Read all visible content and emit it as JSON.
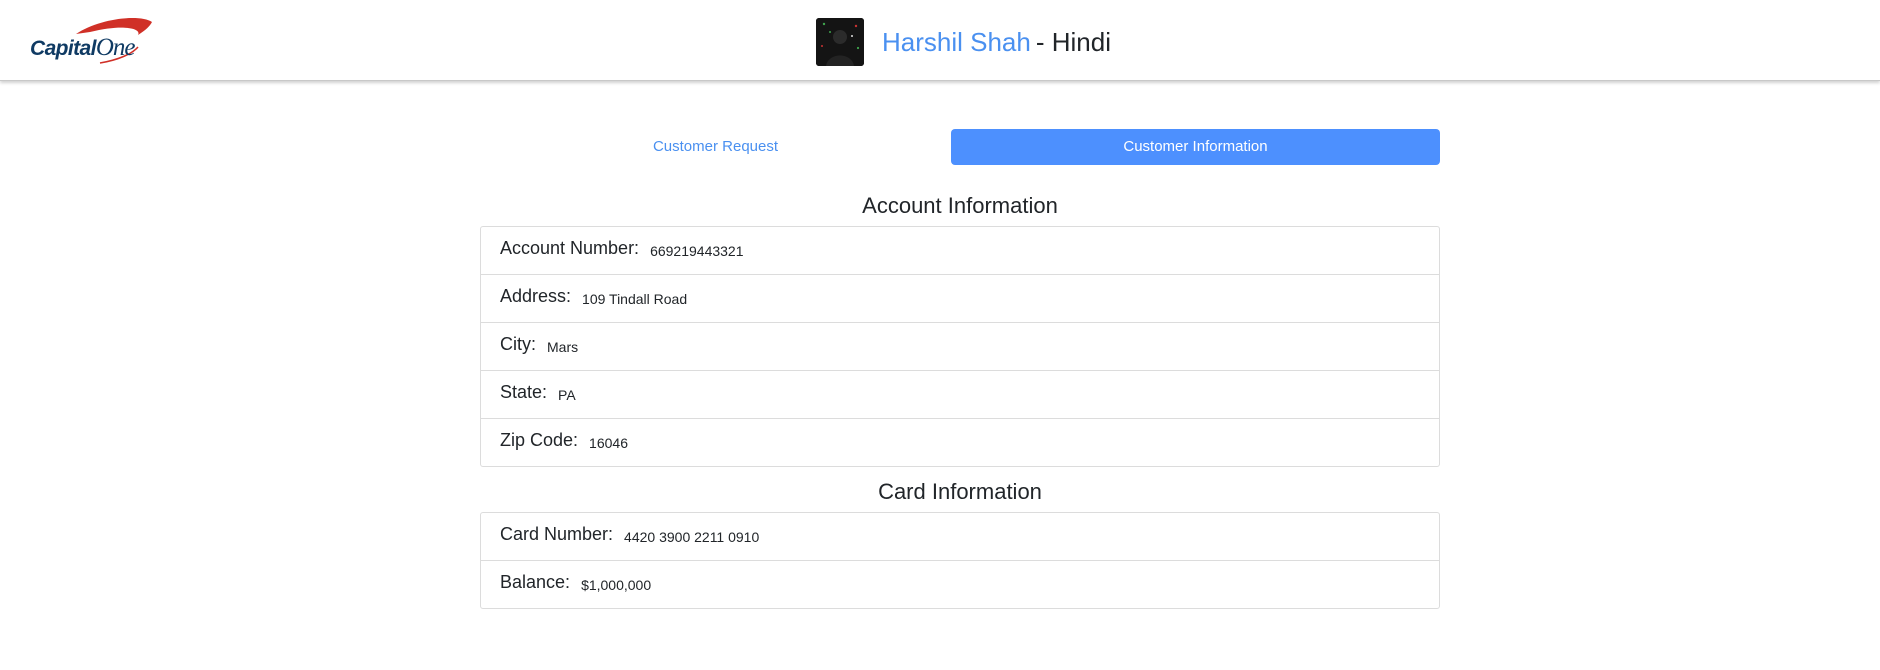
{
  "brand": {
    "logo_text_main": "Capital",
    "logo_text_one": "One",
    "colors": {
      "navy": "#0f3a63",
      "red": "#d03027",
      "accent": "#4d90fe"
    }
  },
  "profile": {
    "name": "Harshil Shah",
    "language": "- Hindi"
  },
  "tabs": [
    {
      "label": "Customer Request",
      "active": false
    },
    {
      "label": "Customer Information",
      "active": true
    }
  ],
  "account": {
    "title": "Account Information",
    "rows": [
      {
        "label": "Account Number:",
        "value": "669219443321"
      },
      {
        "label": "Address:",
        "value": "109 Tindall Road"
      },
      {
        "label": "City:",
        "value": "Mars"
      },
      {
        "label": "State:",
        "value": "PA"
      },
      {
        "label": "Zip Code:",
        "value": "16046"
      }
    ]
  },
  "card": {
    "title": "Card Information",
    "rows": [
      {
        "label": "Card Number:",
        "value": "4420 3900 2211 0910"
      },
      {
        "label": "Balance:",
        "value": "$1,000,000"
      }
    ]
  }
}
